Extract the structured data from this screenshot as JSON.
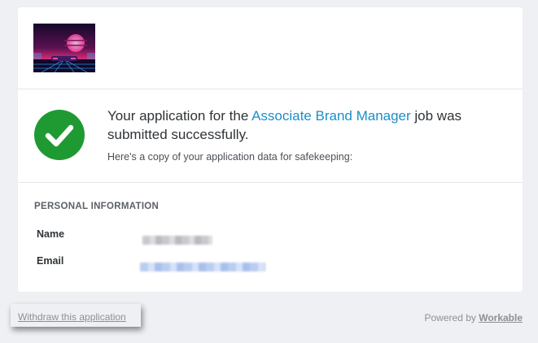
{
  "logo": {
    "icon": "synthwave-sunset-logo",
    "colors": [
      "#1b0a2c",
      "#ff2f8e",
      "#2bb7ff"
    ]
  },
  "success": {
    "icon": "check-circle-icon",
    "color": "#1f9a33",
    "message_prefix": "Your application for the ",
    "job_title": "Associate Brand Manager",
    "message_suffix": " job was submitted successfully.",
    "subtext": "Here's a copy of your application data for safekeeping:"
  },
  "personal_info": {
    "title": "PERSONAL INFORMATION",
    "rows": [
      {
        "label": "Name"
      },
      {
        "label": "Email"
      }
    ]
  },
  "footer": {
    "withdraw_label": "Withdraw this application",
    "powered_by_prefix": "Powered by ",
    "powered_by_brand": "Workable"
  }
}
